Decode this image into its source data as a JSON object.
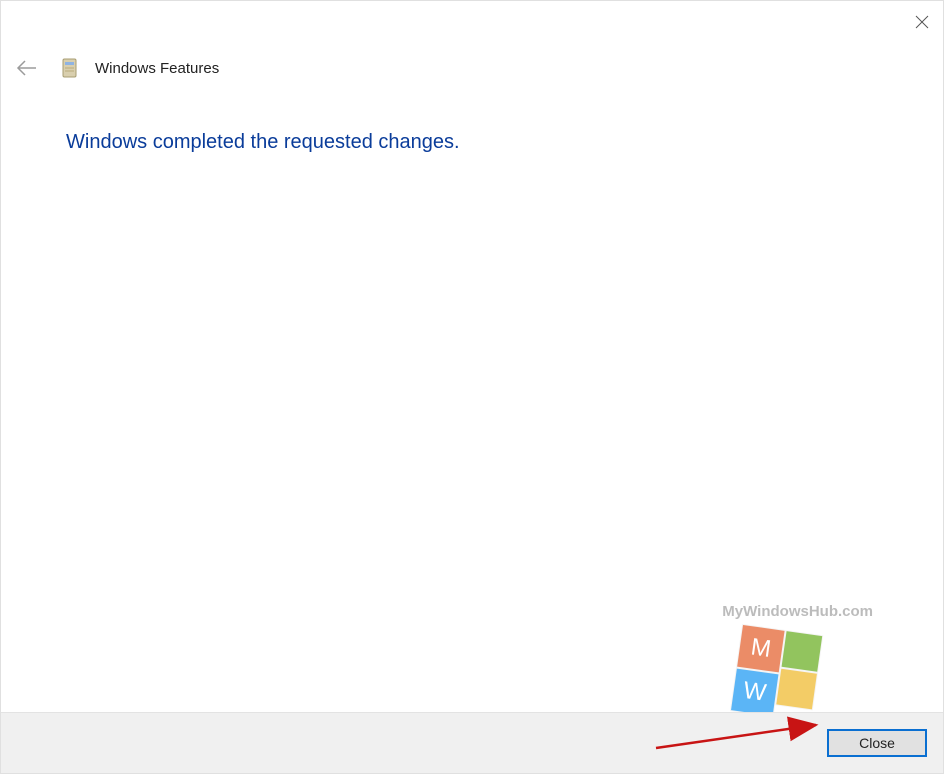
{
  "header": {
    "title": "Windows Features"
  },
  "message": "Windows completed the requested changes.",
  "footer": {
    "close_label": "Close"
  },
  "watermark": {
    "text": "MyWindowsHub.com",
    "letter1": "M",
    "letter2": "W"
  }
}
